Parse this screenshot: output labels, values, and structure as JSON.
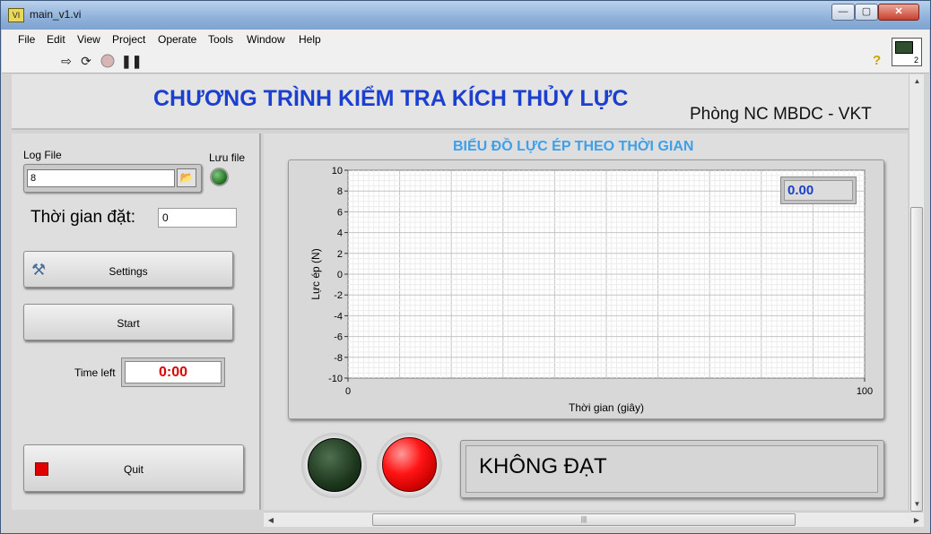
{
  "window": {
    "title": "main_v1.vi",
    "vi_icon_text": "VI",
    "buttons": {
      "minimize": "—",
      "maximize": "▢",
      "close": "✕"
    }
  },
  "menu": {
    "items": [
      "File",
      "Edit",
      "View",
      "Project",
      "Operate",
      "Tools",
      "Window",
      "Help"
    ]
  },
  "toolbar": {
    "connector_number": "2",
    "help_glyph": "?"
  },
  "header": {
    "title": "CHƯƠNG TRÌNH KIỂM TRA KÍCH THỦY LỰC",
    "subtitle": "Phòng NC MBDC - VKT"
  },
  "controls": {
    "log_file_label": "Log File",
    "log_file_value": "8",
    "save_file_label": "Lưu file",
    "time_set_label": "Thời gian đặt:",
    "time_set_value": "0",
    "settings_label": "Settings",
    "start_label": "Start",
    "time_left_label": "Time left",
    "time_left_value": "0:00",
    "quit_label": "Quit"
  },
  "chart_title": "BIỂU ĐỒ LỰC ÉP THEO THỜI GIAN",
  "chart_value_display": "0.00",
  "result_text": "KHÔNG ĐẠT",
  "colors": {
    "title_blue": "#1c3fd0",
    "chart_title_blue": "#3ea0e8",
    "led_red": "#ff1414",
    "led_green_off": "#1c361c",
    "time_left_red": "#e00000"
  },
  "chart_data": {
    "type": "line",
    "title": "BIỂU ĐỒ LỰC ÉP THEO THỜI GIAN",
    "xlabel": "Thời gian (giây)",
    "ylabel": "Lực ép (N)",
    "xlim": [
      0,
      100
    ],
    "ylim": [
      -10,
      10
    ],
    "x_ticks": [
      "0",
      "100"
    ],
    "y_ticks": [
      "10",
      "8",
      "6",
      "4",
      "2",
      "0",
      "-2",
      "-4",
      "-6",
      "-8",
      "-10"
    ],
    "grid": true,
    "series": []
  }
}
